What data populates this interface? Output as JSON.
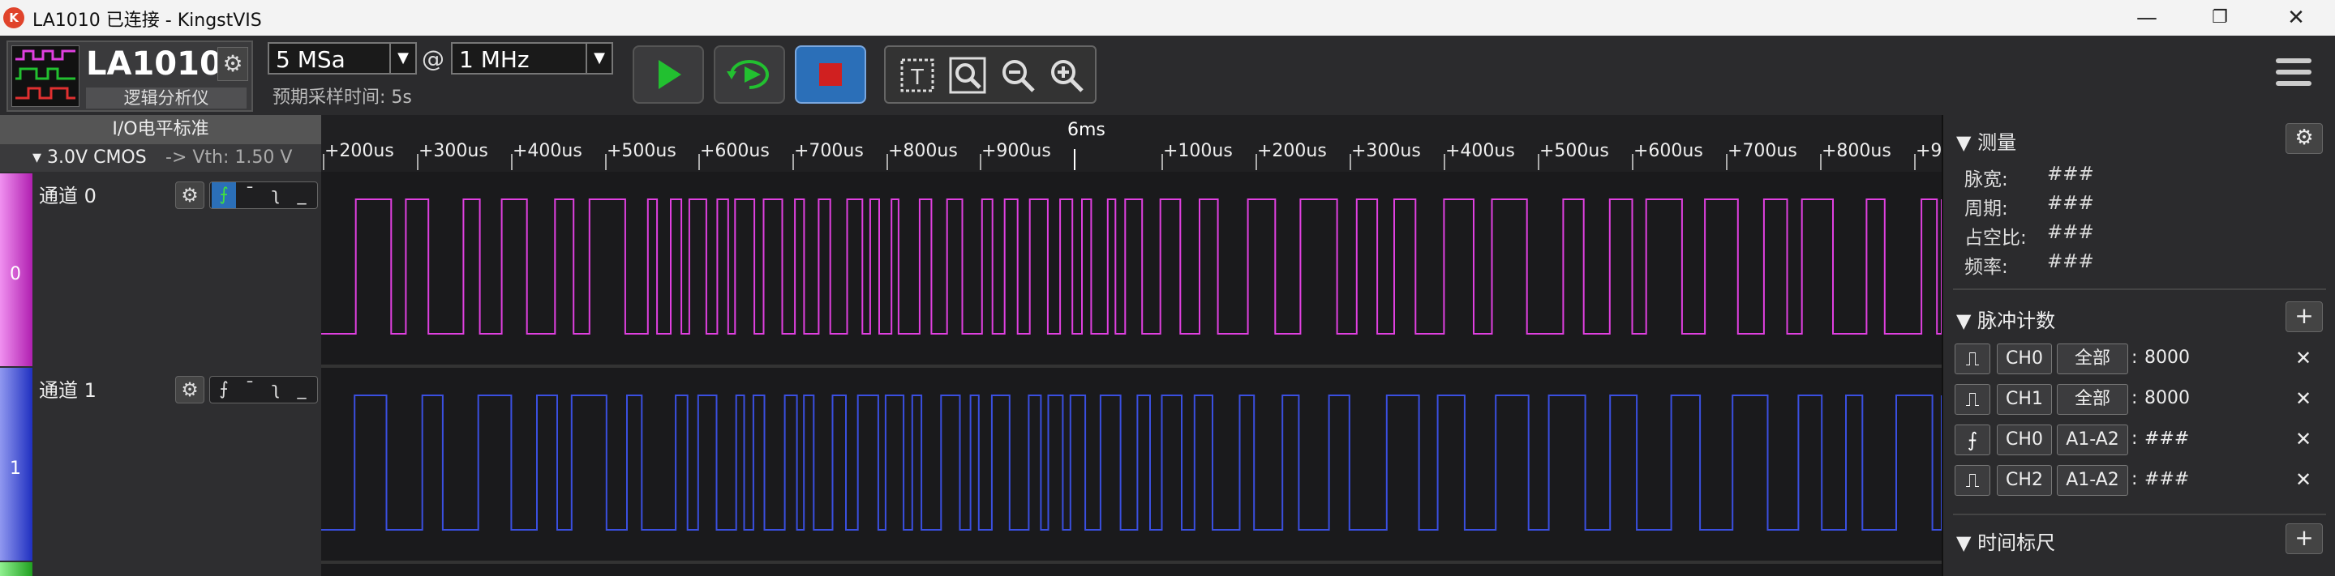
{
  "window": {
    "title": "LA1010 已连接 - KingstVIS",
    "minimize": "—",
    "maximize": "❐",
    "close": "✕"
  },
  "device": {
    "name": "LA1010",
    "subtitle": "逻辑分析仪"
  },
  "sampling": {
    "depth": "5 MSa",
    "at": "@",
    "rate": "1 MHz",
    "estimated_time": "预期采样时间: 5s"
  },
  "io_standard": {
    "header": "I/O电平标准",
    "level": "3.0V CMOS",
    "vth": "-> Vth: 1.50 V"
  },
  "channels": [
    {
      "index": "0",
      "name": "通道 0",
      "color": "#e040e0"
    },
    {
      "index": "1",
      "name": "通道 1",
      "color": "#3a4fe0"
    }
  ],
  "ruler": {
    "major": "6ms",
    "ticks": [
      "+200us",
      "+300us",
      "+400us",
      "+500us",
      "+600us",
      "+700us",
      "+800us",
      "+900us",
      "+100us",
      "+200us",
      "+300us",
      "+400us",
      "+500us",
      "+600us",
      "+700us",
      "+800us",
      "+90"
    ]
  },
  "measure": {
    "title": "测量",
    "rows": [
      {
        "label": "脉宽:",
        "value": "###"
      },
      {
        "label": "周期:",
        "value": "###"
      },
      {
        "label": "占空比:",
        "value": "###"
      },
      {
        "label": "频率:",
        "value": "###"
      }
    ]
  },
  "pulse_count": {
    "title": "脉冲计数",
    "rows": [
      {
        "edge": "pulse-icon",
        "channel": "CH0",
        "range": "全部",
        "value": "8000"
      },
      {
        "edge": "pulse-icon",
        "channel": "CH1",
        "range": "全部",
        "value": "8000"
      },
      {
        "edge": "rising-edge-icon",
        "channel": "CH0",
        "range": "A1-A2",
        "value": "###"
      },
      {
        "edge": "pulse-icon",
        "channel": "CH2",
        "range": "A1-A2",
        "value": "###"
      }
    ]
  },
  "time_ruler": {
    "title": "时间标尺"
  },
  "colors": {
    "ch0": "#e040e0",
    "ch1": "#3a4fe0",
    "stop_button": "#d02020",
    "run_button": "#22c030"
  }
}
